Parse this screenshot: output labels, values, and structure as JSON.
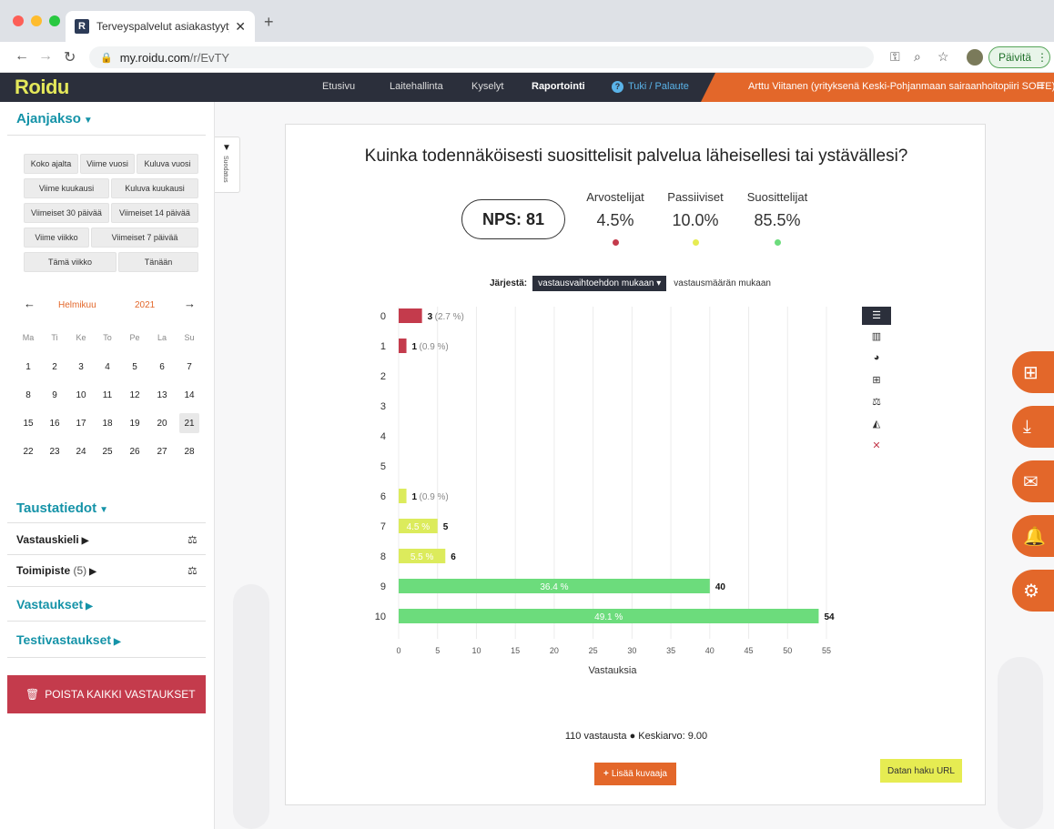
{
  "browser": {
    "tab_title": "Terveyspalvelut asiakastyytyväi",
    "tab_favicon": "R",
    "url_host": "my.roidu.com",
    "url_path": "/r/EvTY",
    "update_label": "Päivitä"
  },
  "header": {
    "logo": "Roidu",
    "nav": [
      "Etusivu",
      "Laitehallinta",
      "Kyselyt",
      "Raportointi"
    ],
    "active_nav": "Raportointi",
    "support": "Tuki / Palaute",
    "user": "Arttu Viitanen (yrityksenä Keski-Pohjanmaan sairaanhoitopiiri SOITE)"
  },
  "sidebar": {
    "period_title": "Ajanjakso",
    "period_buttons": [
      "Koko ajalta",
      "Viime vuosi",
      "Kuluva vuosi",
      "Viime kuukausi",
      "Kuluva kuukausi",
      "Viimeiset 30 päivää",
      "Viimeiset 14 päivää",
      "Viime viikko",
      "Viimeiset 7 päivää",
      "Tämä viikko",
      "Tänään"
    ],
    "calendar": {
      "month": "Helmikuu",
      "year": "2021",
      "weekdays": [
        "Ma",
        "Ti",
        "Ke",
        "To",
        "Pe",
        "La",
        "Su"
      ],
      "weeks": [
        [
          "1",
          "2",
          "3",
          "4",
          "5",
          "6",
          "7"
        ],
        [
          "8",
          "9",
          "10",
          "11",
          "12",
          "13",
          "14"
        ],
        [
          "15",
          "16",
          "17",
          "18",
          "19",
          "20",
          "21"
        ],
        [
          "22",
          "23",
          "24",
          "25",
          "26",
          "27",
          "28"
        ]
      ],
      "today": "21"
    },
    "background_title": "Taustatiedot",
    "answer_language": "Vastauskieli",
    "location": "Toimipiste",
    "location_count": "(5)",
    "answers": "Vastaukset",
    "test_answers": "Testivastaukset",
    "filter_tab": "Suodatus",
    "delete_all": "POISTA KAIKKI VASTAUKSET"
  },
  "card": {
    "question": "Kuinka todennäköisesti suosittelisit palvelua läheisellesi tai ystävällesi?",
    "nps": "NPS: 81",
    "stats": [
      {
        "label": "Arvostelijat",
        "value": "4.5%",
        "color": "#c43b4c"
      },
      {
        "label": "Passiiviset",
        "value": "10.0%",
        "color": "#e6ec52"
      },
      {
        "label": "Suosittelijat",
        "value": "85.5%",
        "color": "#6cdc7c"
      }
    ],
    "sort_label": "Järjestä:",
    "sort_selected": "vastausvaihtoehdon mukaan",
    "sort_alt": "vastausmäärän mukaan",
    "summary": "110 vastausta ● Keskiarvo: 9.00",
    "add_chart": "Lisää kuvaaja",
    "data_url": "Datan haku URL"
  },
  "chart_data": {
    "type": "bar",
    "orientation": "horizontal",
    "xlabel": "Vastauksia",
    "xlim": [
      0,
      55
    ],
    "xticks": [
      0,
      5,
      10,
      15,
      20,
      25,
      30,
      35,
      40,
      45,
      50,
      55
    ],
    "grid": true,
    "categories": [
      "0",
      "1",
      "2",
      "3",
      "4",
      "5",
      "6",
      "7",
      "8",
      "9",
      "10"
    ],
    "values": [
      3,
      1,
      0,
      0,
      0,
      0,
      1,
      5,
      6,
      40,
      54
    ],
    "percent_labels": [
      "2.7 %",
      "0.9 %",
      "",
      "",
      "",
      "",
      "0.9 %",
      "4.5 %",
      "5.5 %",
      "36.4 %",
      "49.1 %"
    ],
    "colors": [
      "#c43b4c",
      "#c43b4c",
      "#c43b4c",
      "#c43b4c",
      "#c43b4c",
      "#c43b4c",
      "#dceb5c",
      "#dceb5c",
      "#dceb5c",
      "#6cdc7c",
      "#6cdc7c"
    ]
  }
}
